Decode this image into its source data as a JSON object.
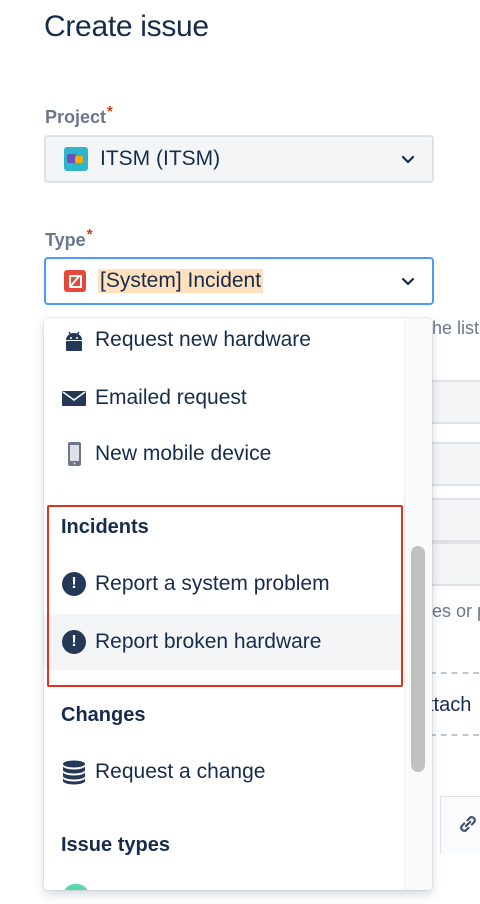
{
  "page_title": "Create issue",
  "project": {
    "label": "Project",
    "required_marker": "*",
    "value": "ITSM (ITSM)",
    "icon": "project-avatar-icon"
  },
  "type": {
    "label": "Type",
    "required_marker": "*",
    "value": "[System] Incident",
    "icon": "incident-icon"
  },
  "background": {
    "hint_fragment": "he list",
    "hint_fragment_2": "es or p",
    "attach_fragment": "ttach"
  },
  "dropdown": {
    "items_top": [
      {
        "label": "Request new hardware",
        "icon": "android-icon"
      },
      {
        "label": "Emailed request",
        "icon": "envelope-icon"
      },
      {
        "label": "New mobile device",
        "icon": "mobile-phone-icon"
      }
    ],
    "groups": [
      {
        "name": "Incidents",
        "items": [
          {
            "label": "Report a system problem",
            "icon": "exclamation-circle-icon",
            "selected": false
          },
          {
            "label": "Report broken hardware",
            "icon": "exclamation-circle-icon",
            "selected": true
          }
        ]
      },
      {
        "name": "Changes",
        "items": [
          {
            "label": "Request a change",
            "icon": "database-icon"
          }
        ]
      },
      {
        "name": "Issue types",
        "items": []
      }
    ]
  },
  "colors": {
    "focus_border": "#4c9aff",
    "required": "#de350b",
    "highlight_box": "#e0331e",
    "selection_highlight": "#ffe2bd"
  }
}
